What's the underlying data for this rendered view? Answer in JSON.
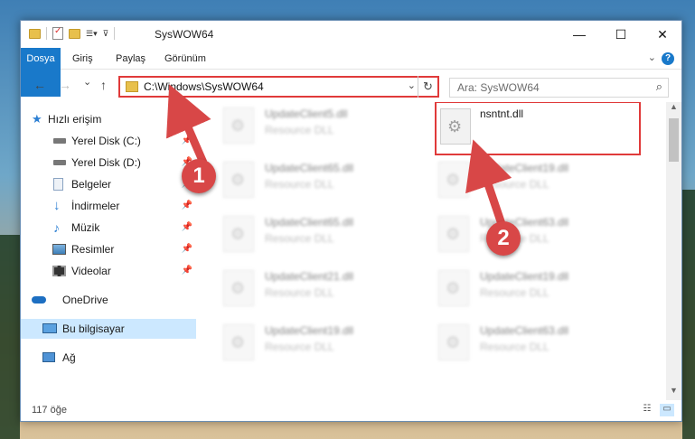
{
  "window": {
    "title": "SysWOW64"
  },
  "ribbon": {
    "tabs": [
      "Dosya",
      "Giriş",
      "Paylaş",
      "Görünüm"
    ],
    "help": "?"
  },
  "nav": {
    "back": "←",
    "forward": "→",
    "recent": "⌄",
    "up": "↑"
  },
  "address": {
    "path": "C:\\Windows\\SysWOW64",
    "dropdown": "⌄",
    "refresh": "↻"
  },
  "search": {
    "placeholder": "Ara: SysWOW64"
  },
  "sidebar": {
    "items": [
      {
        "label": "Hızlı erişim",
        "icon": "star-icon"
      },
      {
        "label": "Yerel Disk (C:)",
        "icon": "drive-icon"
      },
      {
        "label": "Yerel Disk (D:)",
        "icon": "drive-icon"
      },
      {
        "label": "Belgeler",
        "icon": "documents-icon"
      },
      {
        "label": "İndirmeler",
        "icon": "download-icon"
      },
      {
        "label": "Müzik",
        "icon": "music-icon"
      },
      {
        "label": "Resimler",
        "icon": "pictures-icon"
      },
      {
        "label": "Videolar",
        "icon": "video-icon"
      },
      {
        "label": "OneDrive",
        "icon": "cloud-icon"
      },
      {
        "label": "Bu bilgisayar",
        "icon": "computer-icon"
      },
      {
        "label": "Ağ",
        "icon": "network-icon"
      }
    ]
  },
  "files": {
    "left": [
      {
        "name": "UpdateClient5.dll",
        "type": "Resource DLL"
      },
      {
        "name": "UpdateClient65.dll",
        "type": "Resource DLL"
      },
      {
        "name": "UpdateClient65.dll",
        "type": "Resource DLL"
      },
      {
        "name": "UpdateClient21.dll",
        "type": "Resource DLL"
      },
      {
        "name": "UpdateClient19.dll",
        "type": "Resource DLL"
      }
    ],
    "right": [
      {
        "name": "nsntnt.dll",
        "type": ""
      },
      {
        "name": "UpdateClient19.dll",
        "type": "Resource DLL"
      },
      {
        "name": "UpdateClient63.dll",
        "type": "Resource DLL"
      },
      {
        "name": "UpdateClient19.dll",
        "type": "Resource DLL"
      },
      {
        "name": "UpdateClient63.dll",
        "type": "Resource DLL"
      }
    ]
  },
  "status": {
    "count": "117 öğe"
  },
  "annotations": {
    "badge1": "1",
    "badge2": "2"
  },
  "colors": {
    "accent": "#1979ca",
    "highlight": "#e03a3a",
    "badge": "#d84747",
    "selected": "#cce8ff"
  }
}
